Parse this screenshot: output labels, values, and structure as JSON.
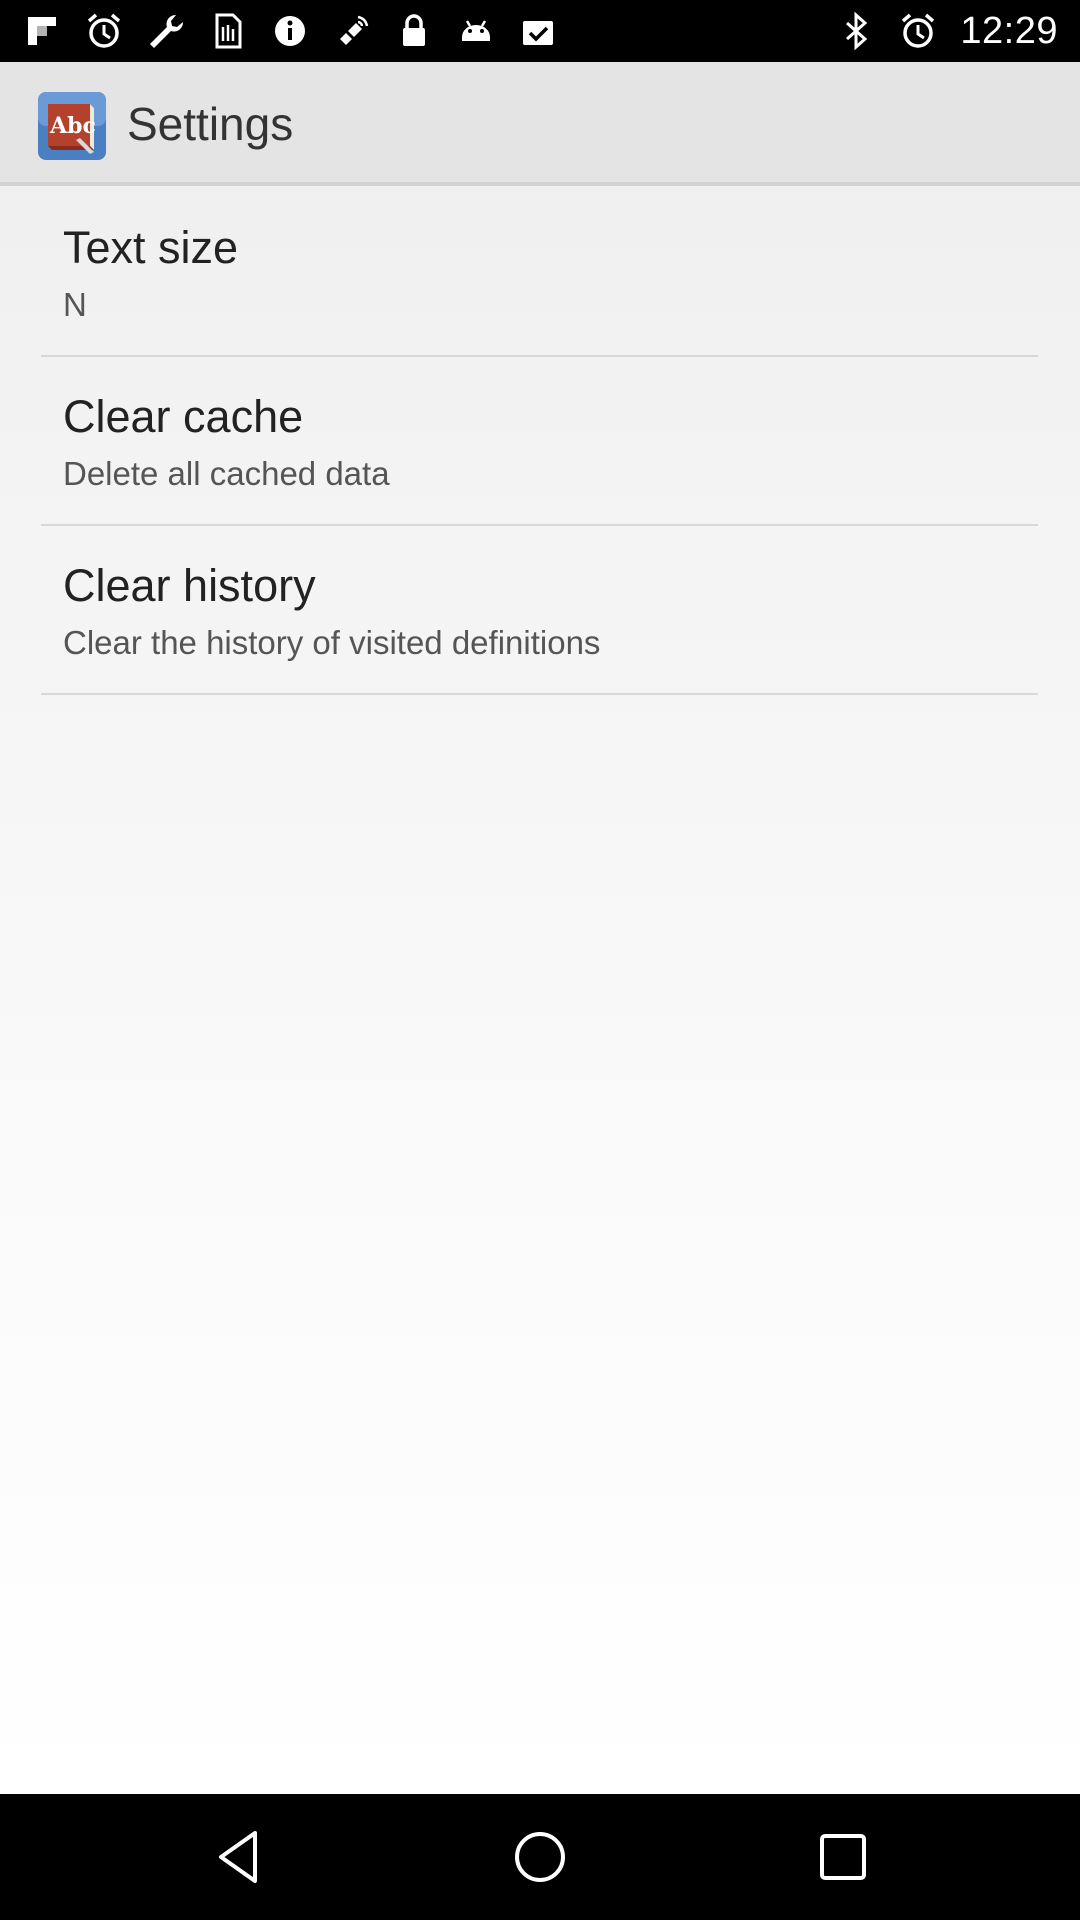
{
  "status_bar": {
    "time": "12:29",
    "left_icons": [
      "flipboard-icon",
      "alarm-clock-icon",
      "wrench-icon",
      "sim-card-icon",
      "info-icon",
      "satellite-icon",
      "lock-icon",
      "android-icon",
      "calendar-check-icon"
    ],
    "right_icons": [
      "bluetooth-icon",
      "alarm-icon"
    ]
  },
  "action_bar": {
    "title": "Settings",
    "app_icon": "dictionary-book-icon"
  },
  "preferences": [
    {
      "title": "Text size",
      "summary": "N"
    },
    {
      "title": "Clear cache",
      "summary": "Delete all cached data"
    },
    {
      "title": "Clear history",
      "summary": "Clear the history of visited definitions"
    }
  ],
  "nav_bar": {
    "buttons": [
      "back-icon",
      "home-icon",
      "recents-icon"
    ]
  },
  "colors": {
    "status_bar": "#000000",
    "action_bar": "#e4e4e4",
    "title_text": "#222222",
    "summary_text": "#555555",
    "divider": "#d8d8d8"
  }
}
